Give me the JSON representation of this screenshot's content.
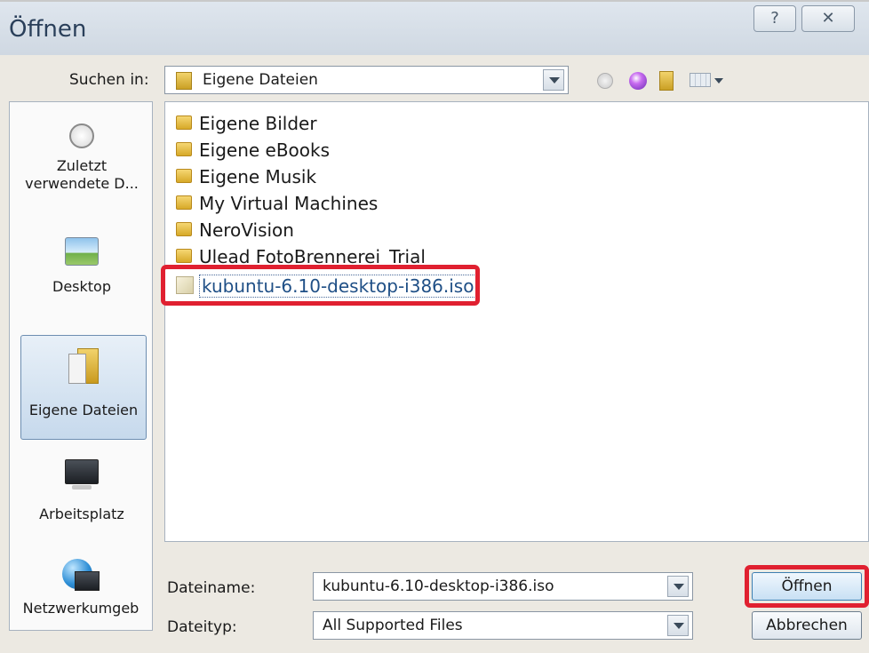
{
  "window": {
    "title": "Öffnen",
    "help_label": "?",
    "close_label": "✕"
  },
  "toolbar": {
    "look_in_label": "Suchen in:",
    "look_in_value": "Eigene Dateien",
    "icons": [
      "back-icon",
      "up-folder-icon",
      "new-folder-icon",
      "views-icon"
    ]
  },
  "places": [
    {
      "label": "Zuletzt verwendete D...",
      "icon": "recent-clock-icon"
    },
    {
      "label": "Desktop",
      "icon": "desktop-icon"
    },
    {
      "label": "Eigene Dateien",
      "icon": "my-documents-icon",
      "selected": true
    },
    {
      "label": "Arbeitsplatz",
      "icon": "computer-icon"
    },
    {
      "label": "Netzwerkumgeb",
      "icon": "network-icon"
    }
  ],
  "files": [
    {
      "name": "Eigene Bilder",
      "icon": "folder-icon"
    },
    {
      "name": "Eigene eBooks",
      "icon": "folder-icon"
    },
    {
      "name": "Eigene Musik",
      "icon": "folder-icon"
    },
    {
      "name": "My Virtual Machines",
      "icon": "folder-icon"
    },
    {
      "name": "NeroVision",
      "icon": "folder-icon"
    },
    {
      "name": "Ulead FotoBrennerei_Trial",
      "icon": "folder-icon"
    },
    {
      "name": "kubuntu-6.10-desktop-i386.iso",
      "icon": "iso-file-icon",
      "selected": true
    }
  ],
  "filename": {
    "label": "Dateiname:",
    "value": "kubuntu-6.10-desktop-i386.iso"
  },
  "filetype": {
    "label": "Dateityp:",
    "value": "All Supported Files"
  },
  "buttons": {
    "open": "Öffnen",
    "cancel": "Abbrechen"
  },
  "colors": {
    "highlight": "#e02030",
    "selection_text": "#1f4f86",
    "titlebar": "#d8e0e8"
  }
}
